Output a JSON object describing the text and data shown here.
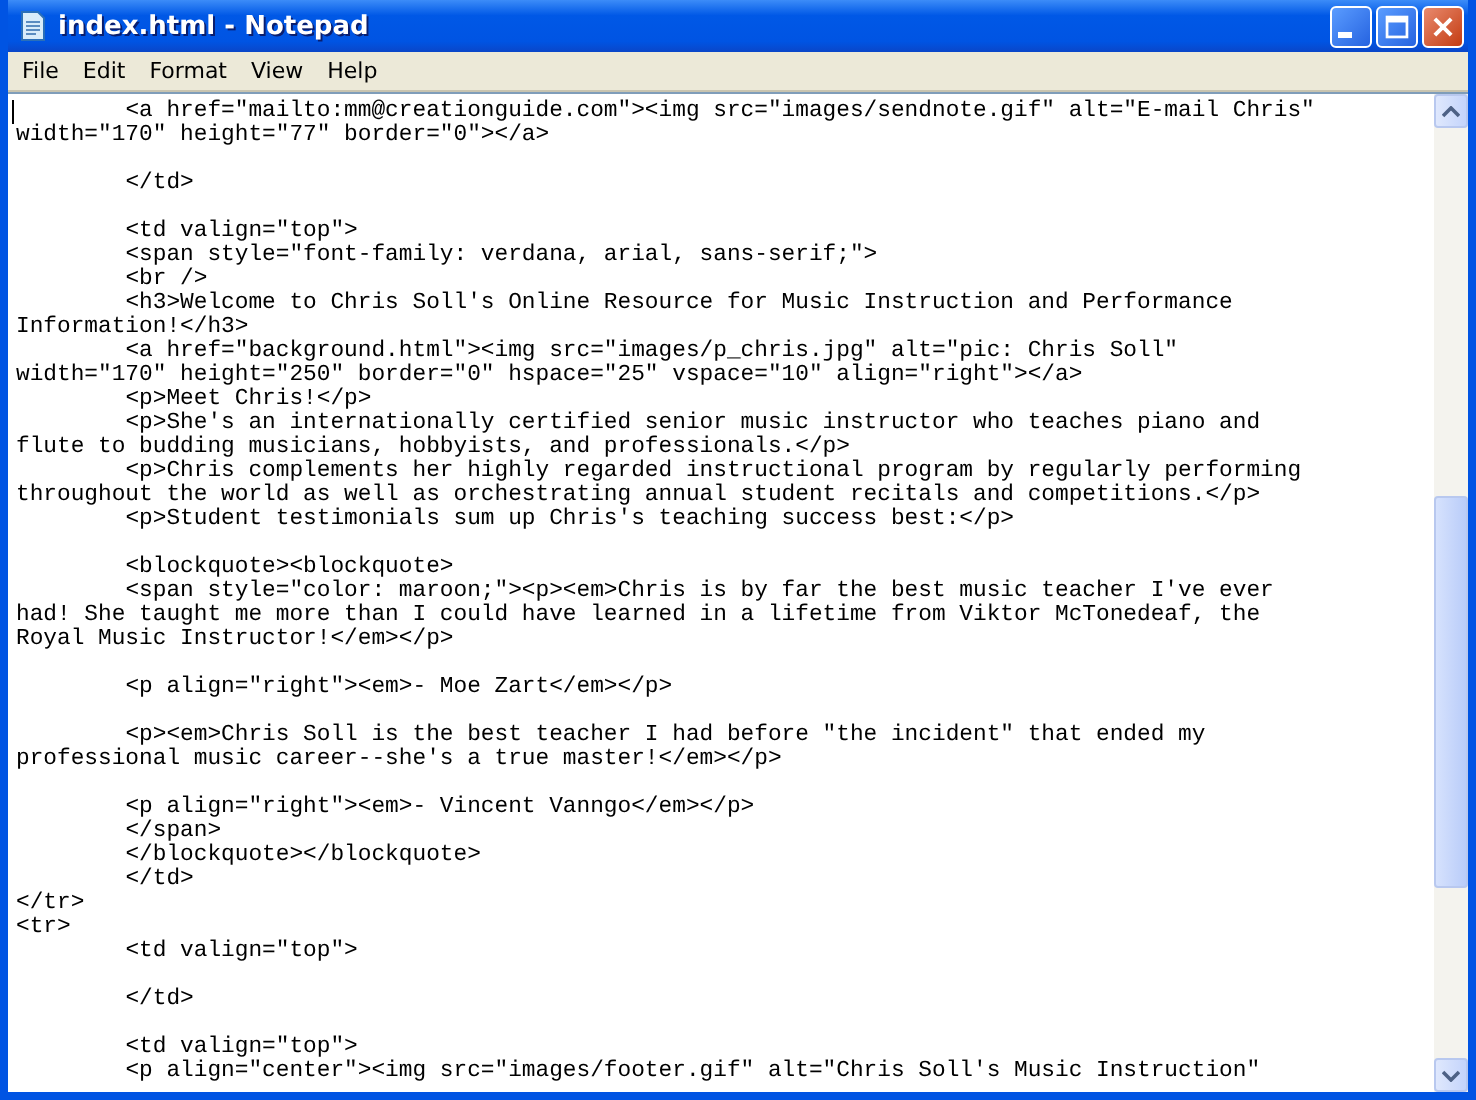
{
  "window": {
    "title": "index.html - Notepad"
  },
  "menu": [
    "File",
    "Edit",
    "Format",
    "View",
    "Help"
  ],
  "editor": {
    "lines": [
      {
        "kind": "text",
        "text": "\t<a href=\"mailto:mm@creationguide.com\"><img src=\"images/sendnote.gif\" alt=\"E-mail Chris\""
      },
      {
        "kind": "text",
        "text": "width=\"170\" height=\"77\" border=\"0\"></a>"
      },
      {
        "kind": "blank"
      },
      {
        "kind": "text",
        "text": "\t</td>"
      },
      {
        "kind": "blank"
      },
      {
        "kind": "text",
        "text": "\t<td valign=\"top\">"
      },
      {
        "kind": "text",
        "text": "\t<span style=\"font-family: verdana, arial, sans-serif;\">"
      },
      {
        "kind": "text",
        "text": "\t<br />"
      },
      {
        "kind": "text",
        "text": "\t<h3>Welcome to Chris Soll's Online Resource for Music Instruction and Performance"
      },
      {
        "kind": "text",
        "text": "Information!</h3>"
      },
      {
        "kind": "text",
        "text": "\t<a href=\"background.html\"><img src=\"images/p_chris.jpg\" alt=\"pic: Chris Soll\""
      },
      {
        "kind": "text",
        "text": "width=\"170\" height=\"250\" border=\"0\" hspace=\"25\" vspace=\"10\" align=\"right\"></a>"
      },
      {
        "kind": "text",
        "text": "\t<p>Meet Chris!</p>"
      },
      {
        "kind": "text",
        "text": "\t<p>She's an internationally certified senior music instructor who teaches piano and"
      },
      {
        "kind": "text",
        "text": "flute to budding musicians, hobbyists, and professionals.</p>"
      },
      {
        "kind": "text",
        "text": "\t<p>Chris complements her highly regarded instructional program by regularly performing"
      },
      {
        "kind": "text",
        "text": "throughout the world as well as orchestrating annual student recitals and competitions.</p>"
      },
      {
        "kind": "text",
        "text": "\t<p>Student testimonials sum up Chris's teaching success best:</p>"
      },
      {
        "kind": "blank"
      },
      {
        "kind": "text",
        "text": "\t<blockquote><blockquote>"
      },
      {
        "kind": "text",
        "text": "\t<span style=\"color: maroon;\"><p><em>Chris is by far the best music teacher I've ever"
      },
      {
        "kind": "text",
        "text": "had! She taught me more than I could have learned in a lifetime from Viktor McTonedeaf, the"
      },
      {
        "kind": "text",
        "text": "Royal Music Instructor!</em></p>"
      },
      {
        "kind": "blank"
      },
      {
        "kind": "text",
        "text": "\t<p align=\"right\"><em>- Moe Zart</em></p>"
      },
      {
        "kind": "blank"
      },
      {
        "kind": "text",
        "text": "\t<p><em>Chris Soll is the best teacher I had before \"the incident\" that ended my"
      },
      {
        "kind": "text",
        "text": "professional music career--she's a true master!</em></p>"
      },
      {
        "kind": "blank"
      },
      {
        "kind": "text",
        "text": "\t<p align=\"right\"><em>- Vincent Vanngo</em></p>"
      },
      {
        "kind": "text",
        "text": "\t</span>"
      },
      {
        "kind": "text",
        "text": "\t</blockquote></blockquote>"
      },
      {
        "kind": "text",
        "text": "\t</td>"
      },
      {
        "kind": "text",
        "text": "</tr>"
      },
      {
        "kind": "text",
        "text": "<tr>"
      },
      {
        "kind": "text",
        "text": "\t<td valign=\"top\">"
      },
      {
        "kind": "blank"
      },
      {
        "kind": "text",
        "text": "\t</td>"
      },
      {
        "kind": "blank"
      },
      {
        "kind": "text",
        "text": "\t<td valign=\"top\">"
      },
      {
        "kind": "text",
        "text": "\t<p align=\"center\"><img src=\"images/footer.gif\" alt=\"Chris Soll's Music Instruction\""
      }
    ]
  }
}
